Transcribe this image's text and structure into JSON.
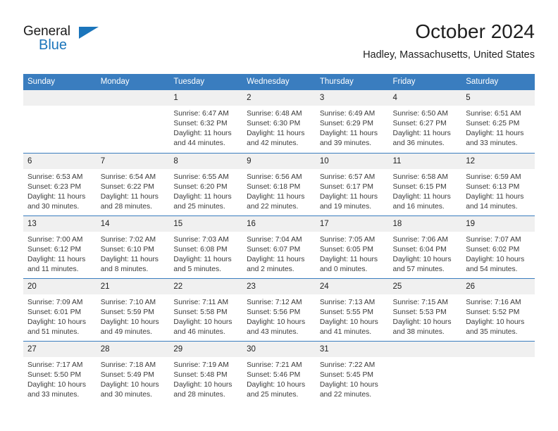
{
  "brand": {
    "name_part1": "General",
    "name_part2": "Blue",
    "accent_color": "#1b75bb",
    "triangle_icon": "brand-triangle-icon"
  },
  "header": {
    "month_title": "October 2024",
    "location": "Hadley, Massachusetts, United States"
  },
  "calendar": {
    "header_background": "#3a7dbf",
    "daynum_background": "#f0f0f0",
    "weekday_headers": [
      "Sunday",
      "Monday",
      "Tuesday",
      "Wednesday",
      "Thursday",
      "Friday",
      "Saturday"
    ],
    "weeks": [
      [
        {
          "day": "",
          "sunrise": "",
          "sunset": "",
          "daylight_line1": "",
          "daylight_line2": ""
        },
        {
          "day": "",
          "sunrise": "",
          "sunset": "",
          "daylight_line1": "",
          "daylight_line2": ""
        },
        {
          "day": "1",
          "sunrise": "Sunrise: 6:47 AM",
          "sunset": "Sunset: 6:32 PM",
          "daylight_line1": "Daylight: 11 hours",
          "daylight_line2": "and 44 minutes."
        },
        {
          "day": "2",
          "sunrise": "Sunrise: 6:48 AM",
          "sunset": "Sunset: 6:30 PM",
          "daylight_line1": "Daylight: 11 hours",
          "daylight_line2": "and 42 minutes."
        },
        {
          "day": "3",
          "sunrise": "Sunrise: 6:49 AM",
          "sunset": "Sunset: 6:29 PM",
          "daylight_line1": "Daylight: 11 hours",
          "daylight_line2": "and 39 minutes."
        },
        {
          "day": "4",
          "sunrise": "Sunrise: 6:50 AM",
          "sunset": "Sunset: 6:27 PM",
          "daylight_line1": "Daylight: 11 hours",
          "daylight_line2": "and 36 minutes."
        },
        {
          "day": "5",
          "sunrise": "Sunrise: 6:51 AM",
          "sunset": "Sunset: 6:25 PM",
          "daylight_line1": "Daylight: 11 hours",
          "daylight_line2": "and 33 minutes."
        }
      ],
      [
        {
          "day": "6",
          "sunrise": "Sunrise: 6:53 AM",
          "sunset": "Sunset: 6:23 PM",
          "daylight_line1": "Daylight: 11 hours",
          "daylight_line2": "and 30 minutes."
        },
        {
          "day": "7",
          "sunrise": "Sunrise: 6:54 AM",
          "sunset": "Sunset: 6:22 PM",
          "daylight_line1": "Daylight: 11 hours",
          "daylight_line2": "and 28 minutes."
        },
        {
          "day": "8",
          "sunrise": "Sunrise: 6:55 AM",
          "sunset": "Sunset: 6:20 PM",
          "daylight_line1": "Daylight: 11 hours",
          "daylight_line2": "and 25 minutes."
        },
        {
          "day": "9",
          "sunrise": "Sunrise: 6:56 AM",
          "sunset": "Sunset: 6:18 PM",
          "daylight_line1": "Daylight: 11 hours",
          "daylight_line2": "and 22 minutes."
        },
        {
          "day": "10",
          "sunrise": "Sunrise: 6:57 AM",
          "sunset": "Sunset: 6:17 PM",
          "daylight_line1": "Daylight: 11 hours",
          "daylight_line2": "and 19 minutes."
        },
        {
          "day": "11",
          "sunrise": "Sunrise: 6:58 AM",
          "sunset": "Sunset: 6:15 PM",
          "daylight_line1": "Daylight: 11 hours",
          "daylight_line2": "and 16 minutes."
        },
        {
          "day": "12",
          "sunrise": "Sunrise: 6:59 AM",
          "sunset": "Sunset: 6:13 PM",
          "daylight_line1": "Daylight: 11 hours",
          "daylight_line2": "and 14 minutes."
        }
      ],
      [
        {
          "day": "13",
          "sunrise": "Sunrise: 7:00 AM",
          "sunset": "Sunset: 6:12 PM",
          "daylight_line1": "Daylight: 11 hours",
          "daylight_line2": "and 11 minutes."
        },
        {
          "day": "14",
          "sunrise": "Sunrise: 7:02 AM",
          "sunset": "Sunset: 6:10 PM",
          "daylight_line1": "Daylight: 11 hours",
          "daylight_line2": "and 8 minutes."
        },
        {
          "day": "15",
          "sunrise": "Sunrise: 7:03 AM",
          "sunset": "Sunset: 6:08 PM",
          "daylight_line1": "Daylight: 11 hours",
          "daylight_line2": "and 5 minutes."
        },
        {
          "day": "16",
          "sunrise": "Sunrise: 7:04 AM",
          "sunset": "Sunset: 6:07 PM",
          "daylight_line1": "Daylight: 11 hours",
          "daylight_line2": "and 2 minutes."
        },
        {
          "day": "17",
          "sunrise": "Sunrise: 7:05 AM",
          "sunset": "Sunset: 6:05 PM",
          "daylight_line1": "Daylight: 11 hours",
          "daylight_line2": "and 0 minutes."
        },
        {
          "day": "18",
          "sunrise": "Sunrise: 7:06 AM",
          "sunset": "Sunset: 6:04 PM",
          "daylight_line1": "Daylight: 10 hours",
          "daylight_line2": "and 57 minutes."
        },
        {
          "day": "19",
          "sunrise": "Sunrise: 7:07 AM",
          "sunset": "Sunset: 6:02 PM",
          "daylight_line1": "Daylight: 10 hours",
          "daylight_line2": "and 54 minutes."
        }
      ],
      [
        {
          "day": "20",
          "sunrise": "Sunrise: 7:09 AM",
          "sunset": "Sunset: 6:01 PM",
          "daylight_line1": "Daylight: 10 hours",
          "daylight_line2": "and 51 minutes."
        },
        {
          "day": "21",
          "sunrise": "Sunrise: 7:10 AM",
          "sunset": "Sunset: 5:59 PM",
          "daylight_line1": "Daylight: 10 hours",
          "daylight_line2": "and 49 minutes."
        },
        {
          "day": "22",
          "sunrise": "Sunrise: 7:11 AM",
          "sunset": "Sunset: 5:58 PM",
          "daylight_line1": "Daylight: 10 hours",
          "daylight_line2": "and 46 minutes."
        },
        {
          "day": "23",
          "sunrise": "Sunrise: 7:12 AM",
          "sunset": "Sunset: 5:56 PM",
          "daylight_line1": "Daylight: 10 hours",
          "daylight_line2": "and 43 minutes."
        },
        {
          "day": "24",
          "sunrise": "Sunrise: 7:13 AM",
          "sunset": "Sunset: 5:55 PM",
          "daylight_line1": "Daylight: 10 hours",
          "daylight_line2": "and 41 minutes."
        },
        {
          "day": "25",
          "sunrise": "Sunrise: 7:15 AM",
          "sunset": "Sunset: 5:53 PM",
          "daylight_line1": "Daylight: 10 hours",
          "daylight_line2": "and 38 minutes."
        },
        {
          "day": "26",
          "sunrise": "Sunrise: 7:16 AM",
          "sunset": "Sunset: 5:52 PM",
          "daylight_line1": "Daylight: 10 hours",
          "daylight_line2": "and 35 minutes."
        }
      ],
      [
        {
          "day": "27",
          "sunrise": "Sunrise: 7:17 AM",
          "sunset": "Sunset: 5:50 PM",
          "daylight_line1": "Daylight: 10 hours",
          "daylight_line2": "and 33 minutes."
        },
        {
          "day": "28",
          "sunrise": "Sunrise: 7:18 AM",
          "sunset": "Sunset: 5:49 PM",
          "daylight_line1": "Daylight: 10 hours",
          "daylight_line2": "and 30 minutes."
        },
        {
          "day": "29",
          "sunrise": "Sunrise: 7:19 AM",
          "sunset": "Sunset: 5:48 PM",
          "daylight_line1": "Daylight: 10 hours",
          "daylight_line2": "and 28 minutes."
        },
        {
          "day": "30",
          "sunrise": "Sunrise: 7:21 AM",
          "sunset": "Sunset: 5:46 PM",
          "daylight_line1": "Daylight: 10 hours",
          "daylight_line2": "and 25 minutes."
        },
        {
          "day": "31",
          "sunrise": "Sunrise: 7:22 AM",
          "sunset": "Sunset: 5:45 PM",
          "daylight_line1": "Daylight: 10 hours",
          "daylight_line2": "and 22 minutes."
        },
        {
          "day": "",
          "sunrise": "",
          "sunset": "",
          "daylight_line1": "",
          "daylight_line2": ""
        },
        {
          "day": "",
          "sunrise": "",
          "sunset": "",
          "daylight_line1": "",
          "daylight_line2": ""
        }
      ]
    ]
  }
}
